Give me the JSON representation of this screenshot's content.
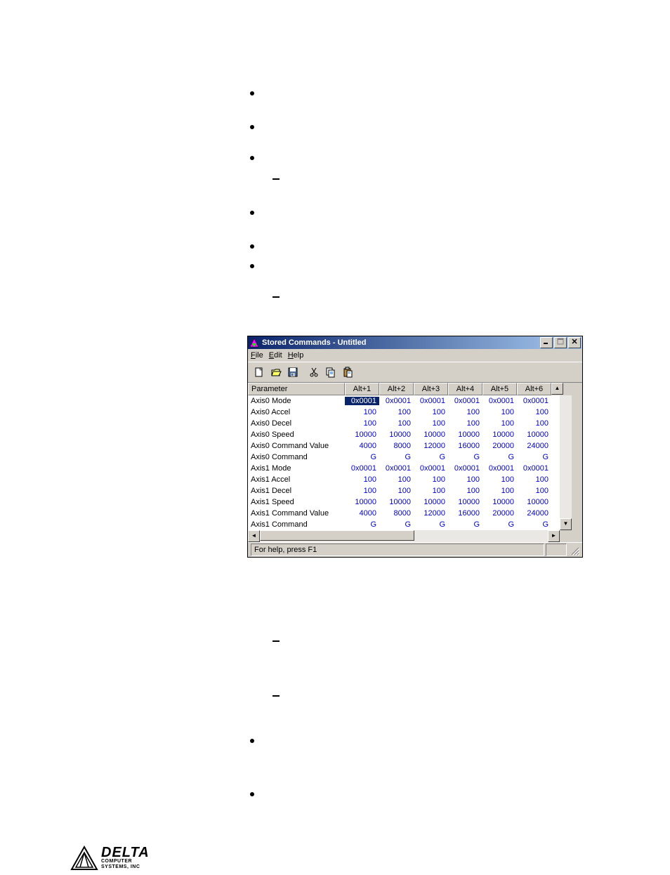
{
  "window": {
    "title": "Stored Commands - Untitled",
    "menu": {
      "file": "File",
      "edit": "Edit",
      "help": "Help"
    },
    "status": "For help, press F1"
  },
  "grid": {
    "param_header": "Parameter",
    "columns": [
      "Alt+1",
      "Alt+2",
      "Alt+3",
      "Alt+4",
      "Alt+5",
      "Alt+6"
    ],
    "rows": [
      {
        "param": "Axis0 Mode",
        "values": [
          "0x0001",
          "0x0001",
          "0x0001",
          "0x0001",
          "0x0001",
          "0x0001"
        ]
      },
      {
        "param": "Axis0 Accel",
        "values": [
          "100",
          "100",
          "100",
          "100",
          "100",
          "100"
        ]
      },
      {
        "param": "Axis0 Decel",
        "values": [
          "100",
          "100",
          "100",
          "100",
          "100",
          "100"
        ]
      },
      {
        "param": "Axis0 Speed",
        "values": [
          "10000",
          "10000",
          "10000",
          "10000",
          "10000",
          "10000"
        ]
      },
      {
        "param": "Axis0 Command Value",
        "values": [
          "4000",
          "8000",
          "12000",
          "16000",
          "20000",
          "24000"
        ]
      },
      {
        "param": "Axis0 Command",
        "values": [
          "G",
          "G",
          "G",
          "G",
          "G",
          "G"
        ]
      },
      {
        "param": "Axis1 Mode",
        "values": [
          "0x0001",
          "0x0001",
          "0x0001",
          "0x0001",
          "0x0001",
          "0x0001"
        ]
      },
      {
        "param": "Axis1 Accel",
        "values": [
          "100",
          "100",
          "100",
          "100",
          "100",
          "100"
        ]
      },
      {
        "param": "Axis1 Decel",
        "values": [
          "100",
          "100",
          "100",
          "100",
          "100",
          "100"
        ]
      },
      {
        "param": "Axis1 Speed",
        "values": [
          "10000",
          "10000",
          "10000",
          "10000",
          "10000",
          "10000"
        ]
      },
      {
        "param": "Axis1 Command Value",
        "values": [
          "4000",
          "8000",
          "12000",
          "16000",
          "20000",
          "24000"
        ]
      },
      {
        "param": "Axis1 Command",
        "values": [
          "G",
          "G",
          "G",
          "G",
          "G",
          "G"
        ]
      }
    ],
    "selected": {
      "row": 0,
      "col": 0
    }
  },
  "toolbar_icons": [
    "new-icon",
    "open-icon",
    "save-icon",
    "cut-icon",
    "copy-icon",
    "paste-icon"
  ],
  "logo": {
    "main": "DELTA",
    "sub1": "COMPUTER",
    "sub2": "SYSTEMS, INC"
  }
}
